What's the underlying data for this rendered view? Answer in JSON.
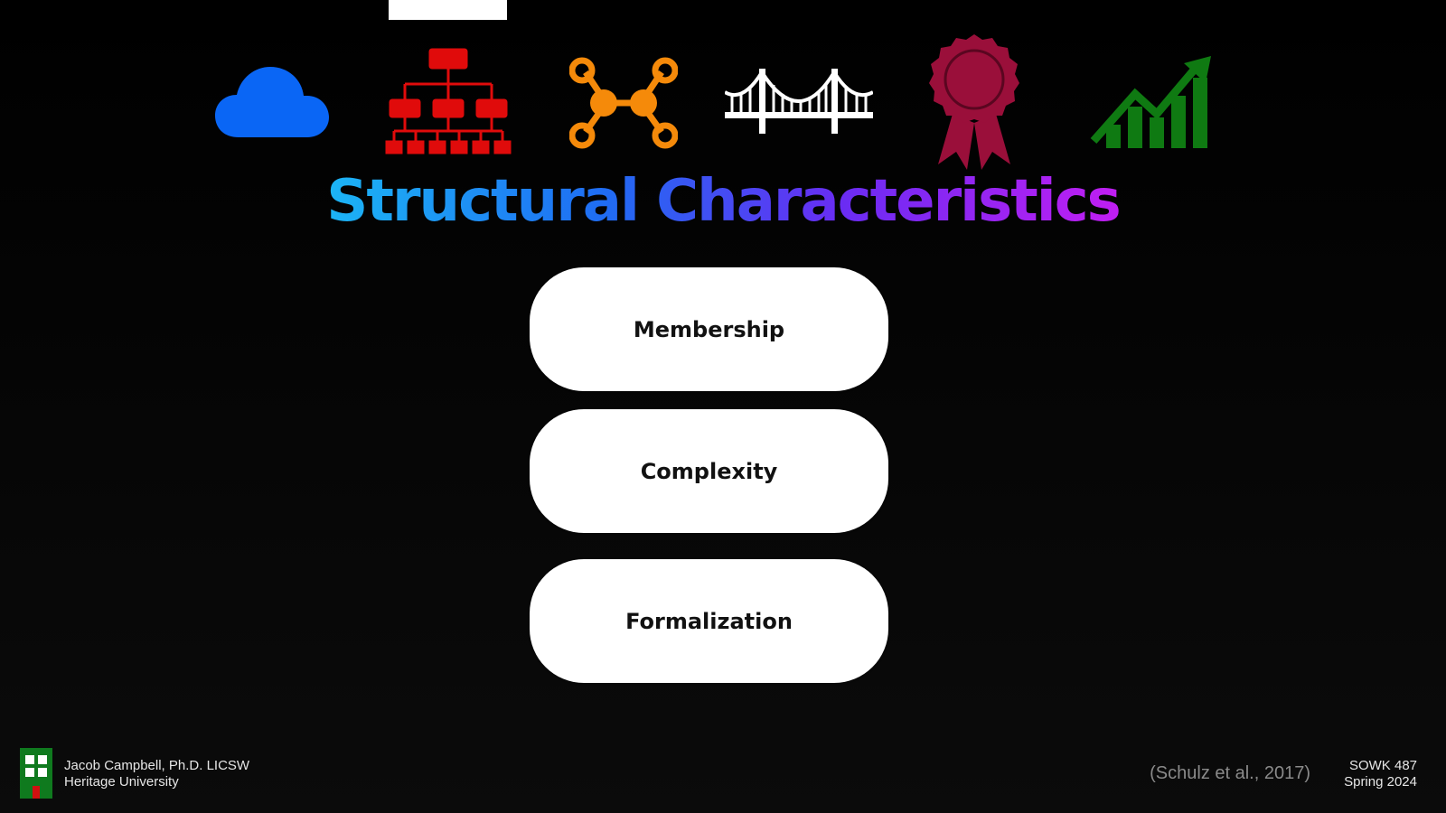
{
  "slide": {
    "title": "Structural Characteristics",
    "icons": [
      "cloud-icon",
      "org-chart-icon",
      "network-nodes-icon",
      "bridge-icon",
      "award-ribbon-icon",
      "growth-chart-icon"
    ],
    "icon_colors": {
      "cloud": "#0a66f5",
      "org": "#e00b0b",
      "nodes": "#f58a0a",
      "bridge": "#ffffff",
      "award": "#9a0f3a",
      "growth": "#0f7a12"
    },
    "title_gradient": [
      "#1cb5f5",
      "#1f6cf3",
      "#6a2cf3",
      "#c11ef2"
    ],
    "items": [
      {
        "label": "Membership"
      },
      {
        "label": "Complexity"
      },
      {
        "label": "Formalization"
      }
    ]
  },
  "footer": {
    "author": "Jacob Campbell, Ph.D. LICSW",
    "institution": "Heritage University",
    "citation": "(Schulz et al., 2017)",
    "course": "SOWK 487",
    "term": "Spring 2024",
    "logo_color": "#0f7a1e"
  }
}
